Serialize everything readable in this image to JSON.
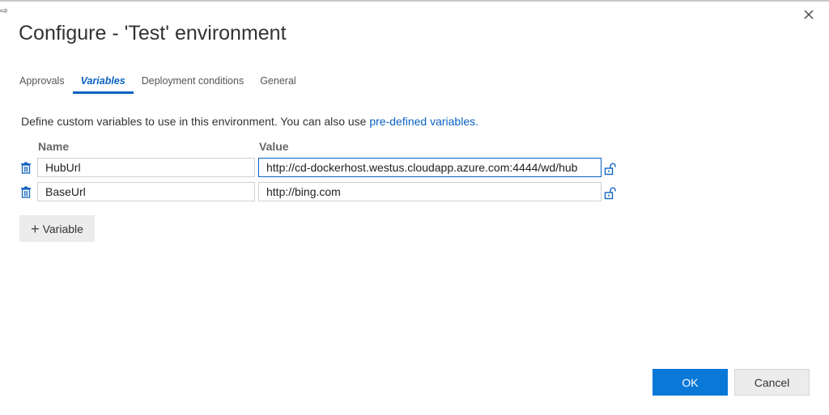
{
  "dialog": {
    "title": "Configure - 'Test' environment",
    "tabs": [
      {
        "label": "Approvals",
        "active": false
      },
      {
        "label": "Variables",
        "active": true
      },
      {
        "label": "Deployment conditions",
        "active": false
      },
      {
        "label": "General",
        "active": false
      }
    ],
    "description": {
      "text": "Define custom variables to use in this environment. You can also use ",
      "link": "pre-defined variables."
    },
    "columns": {
      "name": "Name",
      "value": "Value"
    },
    "variables": [
      {
        "name": "HubUrl",
        "value": "http://cd-dockerhost.westus.cloudapp.azure.com:4444/wd/hub"
      },
      {
        "name": "BaseUrl",
        "value": "http://bing.com"
      }
    ],
    "add_variable_label": "Variable",
    "ok_label": "OK",
    "cancel_label": "Cancel"
  },
  "icons": {
    "close": "close-icon",
    "trash": "trash-icon",
    "lock": "unlock-icon",
    "plus": "plus-icon",
    "corner": "arrow-right-icon"
  },
  "colors": {
    "accent": "#0a78d7",
    "link": "#0a62c2",
    "icon_blue": "#1565c0"
  }
}
